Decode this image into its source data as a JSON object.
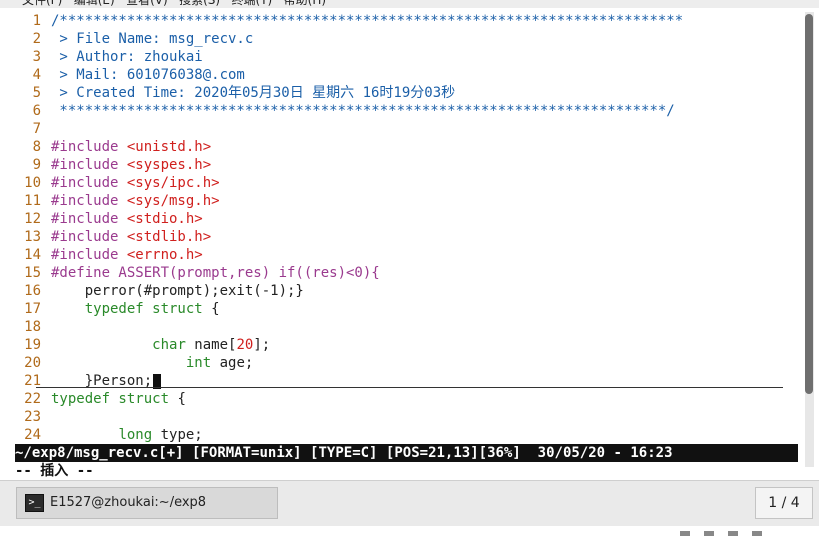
{
  "menubar": {
    "text": "文件(F)   编辑(E)   查看(V)   搜索(S)   终端(T)   帮助(H)"
  },
  "editor": {
    "lines": [
      {
        "n": "1",
        "parts": [
          {
            "t": "/**************************************************************************",
            "c": "cm"
          }
        ]
      },
      {
        "n": "2",
        "parts": [
          {
            "t": " > File Name: msg_recv.c",
            "c": "cm"
          }
        ]
      },
      {
        "n": "3",
        "parts": [
          {
            "t": " > Author: zhoukai",
            "c": "cm"
          }
        ]
      },
      {
        "n": "4",
        "parts": [
          {
            "t": " > Mail: 601076038@.com",
            "c": "cm"
          }
        ]
      },
      {
        "n": "5",
        "parts": [
          {
            "t": " > Created Time: 2020年05月30日 星期六 16时19分03秒",
            "c": "cm"
          }
        ]
      },
      {
        "n": "6",
        "parts": [
          {
            "t": " ************************************************************************/",
            "c": "cm"
          }
        ]
      },
      {
        "n": "7",
        "parts": []
      },
      {
        "n": "8",
        "parts": [
          {
            "t": "#include ",
            "c": "pp"
          },
          {
            "t": "<unistd.h>",
            "c": "str"
          }
        ]
      },
      {
        "n": "9",
        "parts": [
          {
            "t": "#include ",
            "c": "pp"
          },
          {
            "t": "<syspes.h>",
            "c": "str"
          }
        ]
      },
      {
        "n": "10",
        "parts": [
          {
            "t": "#include ",
            "c": "pp"
          },
          {
            "t": "<sys/ipc.h>",
            "c": "str"
          }
        ]
      },
      {
        "n": "11",
        "parts": [
          {
            "t": "#include ",
            "c": "pp"
          },
          {
            "t": "<sys/msg.h>",
            "c": "str"
          }
        ]
      },
      {
        "n": "12",
        "parts": [
          {
            "t": "#include ",
            "c": "pp"
          },
          {
            "t": "<stdio.h>",
            "c": "str"
          }
        ]
      },
      {
        "n": "13",
        "parts": [
          {
            "t": "#include ",
            "c": "pp"
          },
          {
            "t": "<stdlib.h>",
            "c": "str"
          }
        ]
      },
      {
        "n": "14",
        "parts": [
          {
            "t": "#include ",
            "c": "pp"
          },
          {
            "t": "<errno.h>",
            "c": "str"
          }
        ]
      },
      {
        "n": "15",
        "parts": [
          {
            "t": "#define ASSERT(prompt,res) if((res)<0){",
            "c": "pf"
          }
        ]
      },
      {
        "n": "16",
        "parts": [
          {
            "t": "    perror(#prompt);exit(-1);}",
            "c": "tx"
          }
        ]
      },
      {
        "n": "17",
        "parts": [
          {
            "t": "    ",
            "c": "tx"
          },
          {
            "t": "typedef struct",
            "c": "kw"
          },
          {
            "t": " {",
            "c": "tx"
          }
        ]
      },
      {
        "n": "18",
        "parts": []
      },
      {
        "n": "19",
        "parts": [
          {
            "t": "            ",
            "c": "tx"
          },
          {
            "t": "char",
            "c": "kw"
          },
          {
            "t": " name[",
            "c": "tx"
          },
          {
            "t": "20",
            "c": "num"
          },
          {
            "t": "];",
            "c": "tx"
          }
        ]
      },
      {
        "n": "20",
        "parts": [
          {
            "t": "                ",
            "c": "tx"
          },
          {
            "t": "int",
            "c": "kw"
          },
          {
            "t": " age;",
            "c": "tx"
          }
        ]
      },
      {
        "n": "21",
        "parts": [
          {
            "t": "    }Person;",
            "c": "tx"
          }
        ],
        "cursor": true
      },
      {
        "n": "22",
        "parts": [
          {
            "t": "typedef struct",
            "c": "kw"
          },
          {
            "t": " {",
            "c": "tx"
          }
        ]
      },
      {
        "n": "23",
        "parts": []
      },
      {
        "n": "24",
        "parts": [
          {
            "t": "        ",
            "c": "tx"
          },
          {
            "t": "long",
            "c": "kw"
          },
          {
            "t": " type;",
            "c": "tx"
          }
        ]
      }
    ]
  },
  "statusbar": {
    "path": "~/exp8/msg_recv.c",
    "flag": "[+]",
    "format": "[FORMAT=unix]",
    "type": "[TYPE=C]",
    "pos": "[POS=21,13]",
    "percent": "[36%]",
    "datetime": "30/05/20 - 16:23"
  },
  "mode": {
    "text": "-- 插入 --"
  },
  "taskbar": {
    "window_label": "E1527@zhoukai:~/exp8",
    "pager": "1 / 4"
  }
}
